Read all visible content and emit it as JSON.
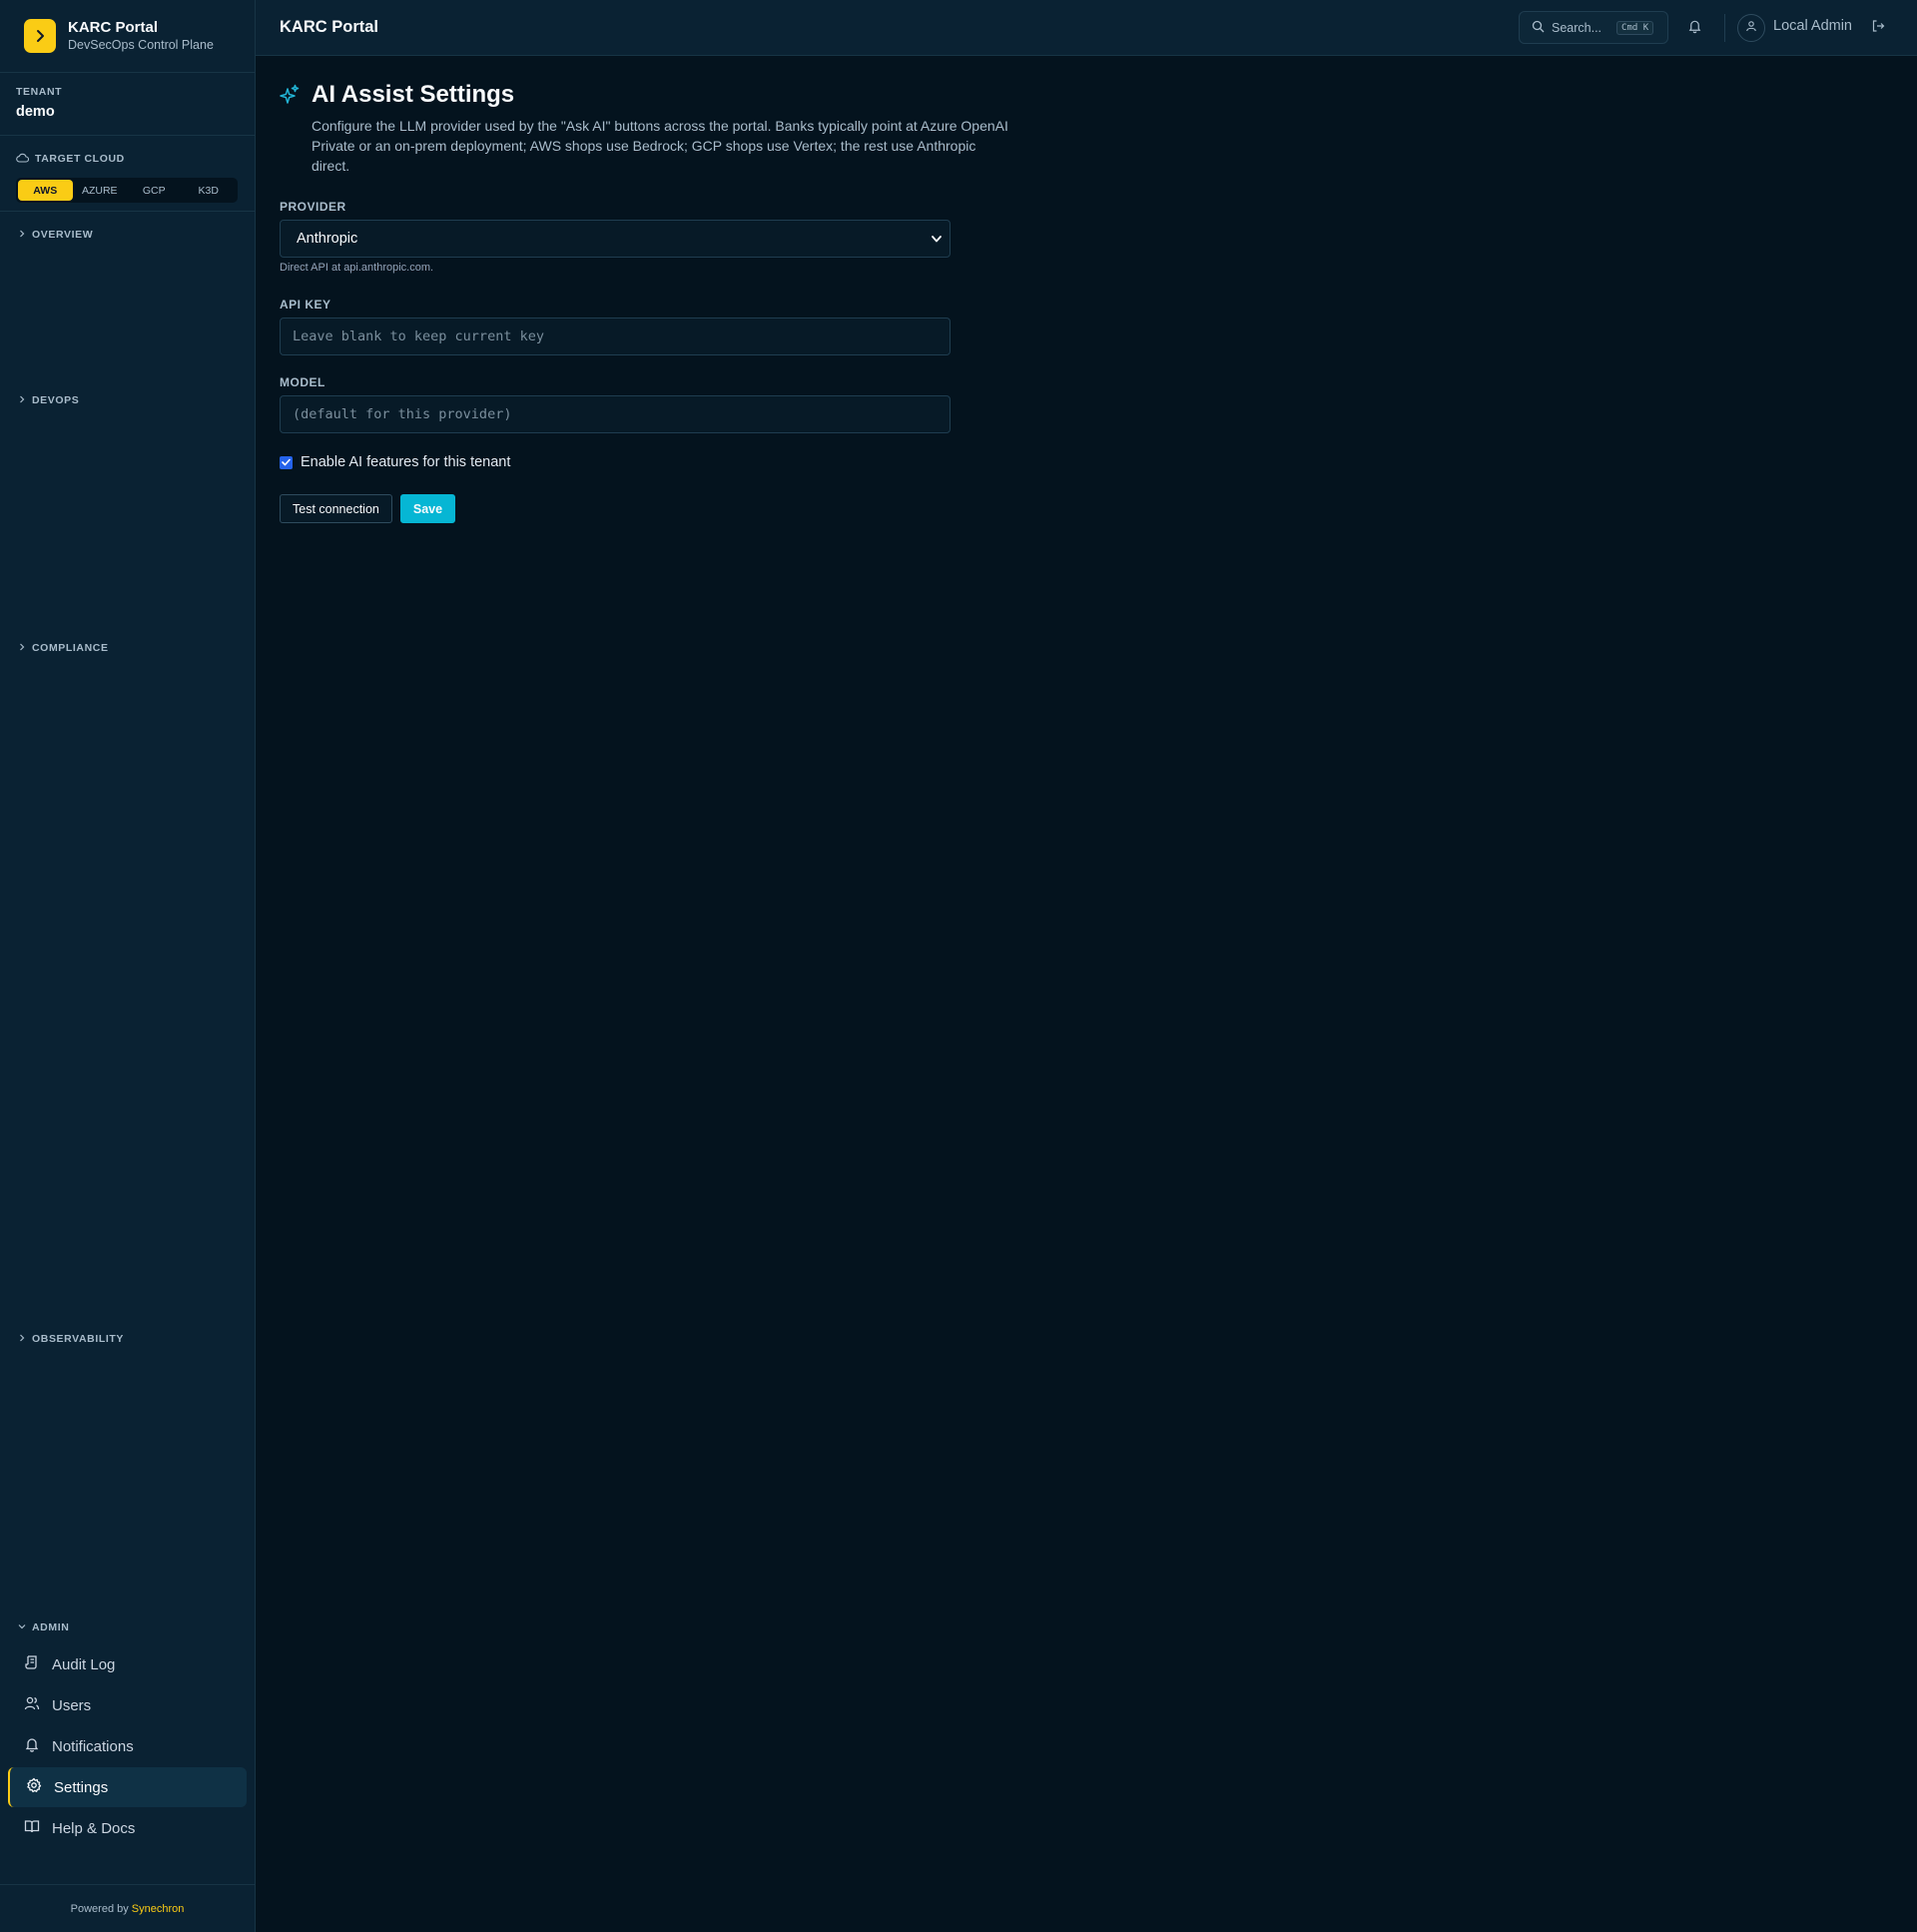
{
  "brand": {
    "title": "KARC Portal",
    "subtitle": "DevSecOps Control Plane"
  },
  "tenant": {
    "label": "TENANT",
    "name": "demo"
  },
  "target_cloud": {
    "label": "TARGET CLOUD",
    "options": [
      "AWS",
      "AZURE",
      "GCP",
      "K3D"
    ],
    "selected": "AWS"
  },
  "nav": {
    "sections": [
      {
        "label": "OVERVIEW",
        "expanded": false
      },
      {
        "label": "DEVOPS",
        "expanded": false
      },
      {
        "label": "COMPLIANCE",
        "expanded": false
      },
      {
        "label": "OBSERVABILITY",
        "expanded": false
      },
      {
        "label": "ADMIN",
        "expanded": true
      }
    ],
    "admin_items": [
      {
        "label": "Audit Log",
        "icon": "scroll-icon"
      },
      {
        "label": "Users",
        "icon": "users-icon"
      },
      {
        "label": "Notifications",
        "icon": "bell-icon"
      },
      {
        "label": "Settings",
        "icon": "gear-icon",
        "active": true
      },
      {
        "label": "Help & Docs",
        "icon": "book-icon"
      }
    ]
  },
  "footer": {
    "prefix": "Powered by",
    "brand": "Synechron"
  },
  "topbar": {
    "title": "KARC Portal",
    "search_placeholder": "Search...",
    "shortcut": "Cmd K",
    "user": "Local Admin"
  },
  "page": {
    "title": "AI Assist Settings",
    "description": "Configure the LLM provider used by the \"Ask AI\" buttons across the portal. Banks typically point at Azure OpenAI Private or an on-prem deployment; AWS shops use Bedrock; GCP shops use Vertex; the rest use Anthropic direct."
  },
  "form": {
    "provider": {
      "label": "PROVIDER",
      "value": "Anthropic",
      "hint": "Direct API at api.anthropic.com."
    },
    "api_key": {
      "label": "API KEY",
      "placeholder": "Leave blank to keep current key"
    },
    "model": {
      "label": "MODEL",
      "placeholder": "(default for this provider)"
    },
    "enable": {
      "label": "Enable AI features for this tenant",
      "checked": true
    },
    "test_button": "Test connection",
    "save_button": "Save"
  },
  "colors": {
    "accent": "#facc15",
    "primary": "#06b6d4",
    "background": "#04131e",
    "sidebar": "#0a2233"
  }
}
